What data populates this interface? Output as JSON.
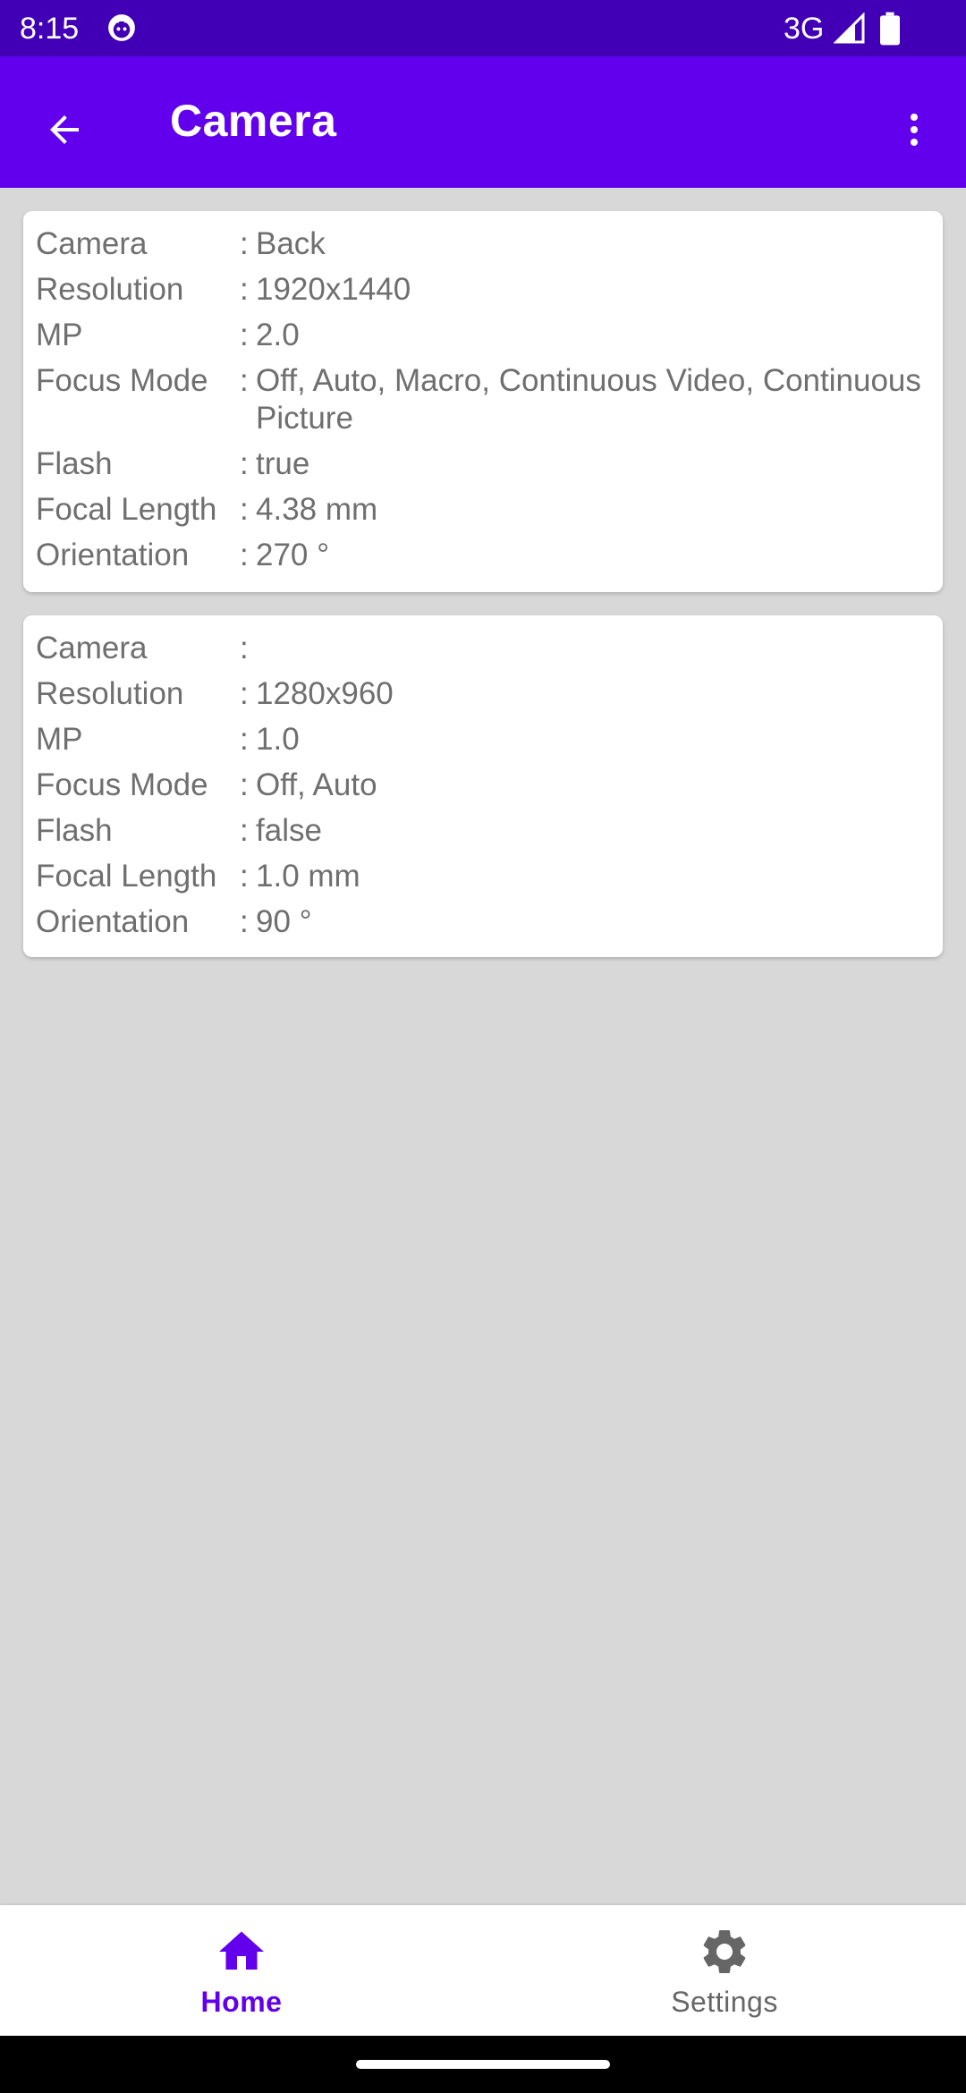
{
  "status_bar": {
    "time": "8:15",
    "network": "3G"
  },
  "app_bar": {
    "title": "Camera",
    "color": "#6200ee"
  },
  "cameras": [
    {
      "rows": [
        {
          "label": "Camera",
          "value": "Back"
        },
        {
          "label": "Resolution",
          "value": "1920x1440"
        },
        {
          "label": "MP",
          "value": "2.0"
        },
        {
          "label": "Focus Mode",
          "value": "Off, Auto, Macro, Continuous Video, Continuous Picture"
        },
        {
          "label": "Flash",
          "value": "true"
        },
        {
          "label": "Focal Length",
          "value": "4.38 mm"
        },
        {
          "label": "Orientation",
          "value": "270 °"
        }
      ]
    },
    {
      "rows": [
        {
          "label": "Camera",
          "value": ""
        },
        {
          "label": "Resolution",
          "value": "1280x960"
        },
        {
          "label": "MP",
          "value": "1.0"
        },
        {
          "label": "Focus Mode",
          "value": "Off, Auto"
        },
        {
          "label": "Flash",
          "value": "false"
        },
        {
          "label": "Focal Length",
          "value": "1.0 mm"
        },
        {
          "label": "Orientation",
          "value": "90 °"
        }
      ]
    }
  ],
  "separator": ":",
  "bottom_nav": {
    "items": [
      {
        "label": "Home",
        "icon": "home-icon",
        "selected": true
      },
      {
        "label": "Settings",
        "icon": "gear-icon",
        "selected": false
      }
    ]
  }
}
